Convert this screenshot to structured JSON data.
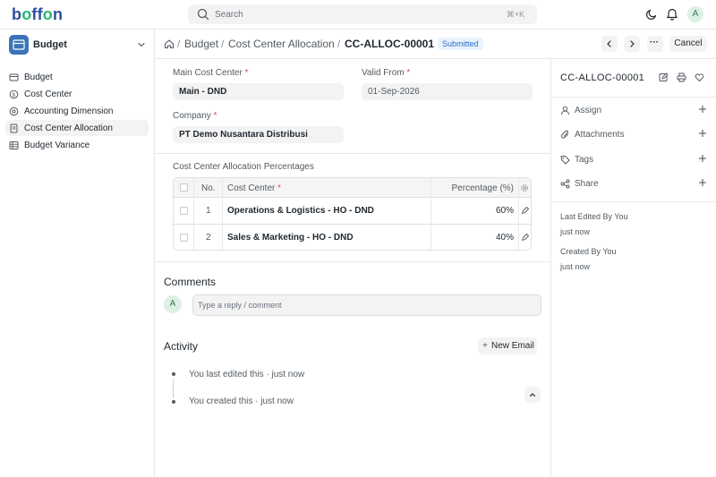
{
  "app": {
    "logo": "boffon",
    "search_placeholder": "Search",
    "search_shortcut": "⌘+K",
    "avatar_initial": "A"
  },
  "sidebar": {
    "workspace": "Budget",
    "items": [
      {
        "label": "Budget",
        "icon": "budget-icon",
        "active": false
      },
      {
        "label": "Cost Center",
        "icon": "cost-center-icon",
        "active": false
      },
      {
        "label": "Accounting Dimension",
        "icon": "accounting-dimension-icon",
        "active": false
      },
      {
        "label": "Cost Center Allocation",
        "icon": "document-icon",
        "active": true
      },
      {
        "label": "Budget Variance",
        "icon": "table-icon",
        "active": false
      }
    ]
  },
  "header": {
    "breadcrumbs": [
      "Budget",
      "Cost Center Allocation",
      "CC-ALLOC-00001"
    ],
    "separator": "/",
    "status": "Submitted",
    "more": "···",
    "cancel_label": "Cancel"
  },
  "form": {
    "main_cost_center": {
      "label": "Main Cost Center",
      "value": "Main - DND"
    },
    "valid_from": {
      "label": "Valid From",
      "value": "01-Sep-2026"
    },
    "company": {
      "label": "Company",
      "value": "PT Demo Nusantara Distribusi"
    },
    "required_mark": "*"
  },
  "allocation": {
    "title": "Cost Center Allocation Percentages",
    "columns": {
      "no": "No.",
      "cost_center": "Cost Center",
      "percentage": "Percentage (%)"
    },
    "rows": [
      {
        "no": "1",
        "cost_center": "Operations & Logistics - HO - DND",
        "percentage": "60%"
      },
      {
        "no": "2",
        "cost_center": "Sales & Marketing - HO - DND",
        "percentage": "40%"
      }
    ]
  },
  "comments": {
    "title": "Comments",
    "avatar_initial": "A",
    "placeholder": "Type a reply / comment"
  },
  "activity": {
    "title": "Activity",
    "new_email_label": "New Email",
    "new_email_plus": "+",
    "items": [
      "You last edited this · just now",
      "You created this · just now"
    ]
  },
  "rpanel": {
    "title": "CC-ALLOC-00001",
    "actions": [
      {
        "label": "Assign",
        "icon": "assign-icon"
      },
      {
        "label": "Attachments",
        "icon": "paperclip-icon"
      },
      {
        "label": "Tags",
        "icon": "tag-icon"
      },
      {
        "label": "Share",
        "icon": "share-icon"
      }
    ],
    "last_edited_label": "Last Edited By You",
    "last_edited_time": "just now",
    "created_label": "Created By You",
    "created_time": "just now"
  },
  "colors": {
    "brand_blue": "#2d4fa0",
    "brand_green": "#2bb673",
    "status_blue": "#2e6fc7",
    "workspace_icon": "#3b74b8"
  }
}
